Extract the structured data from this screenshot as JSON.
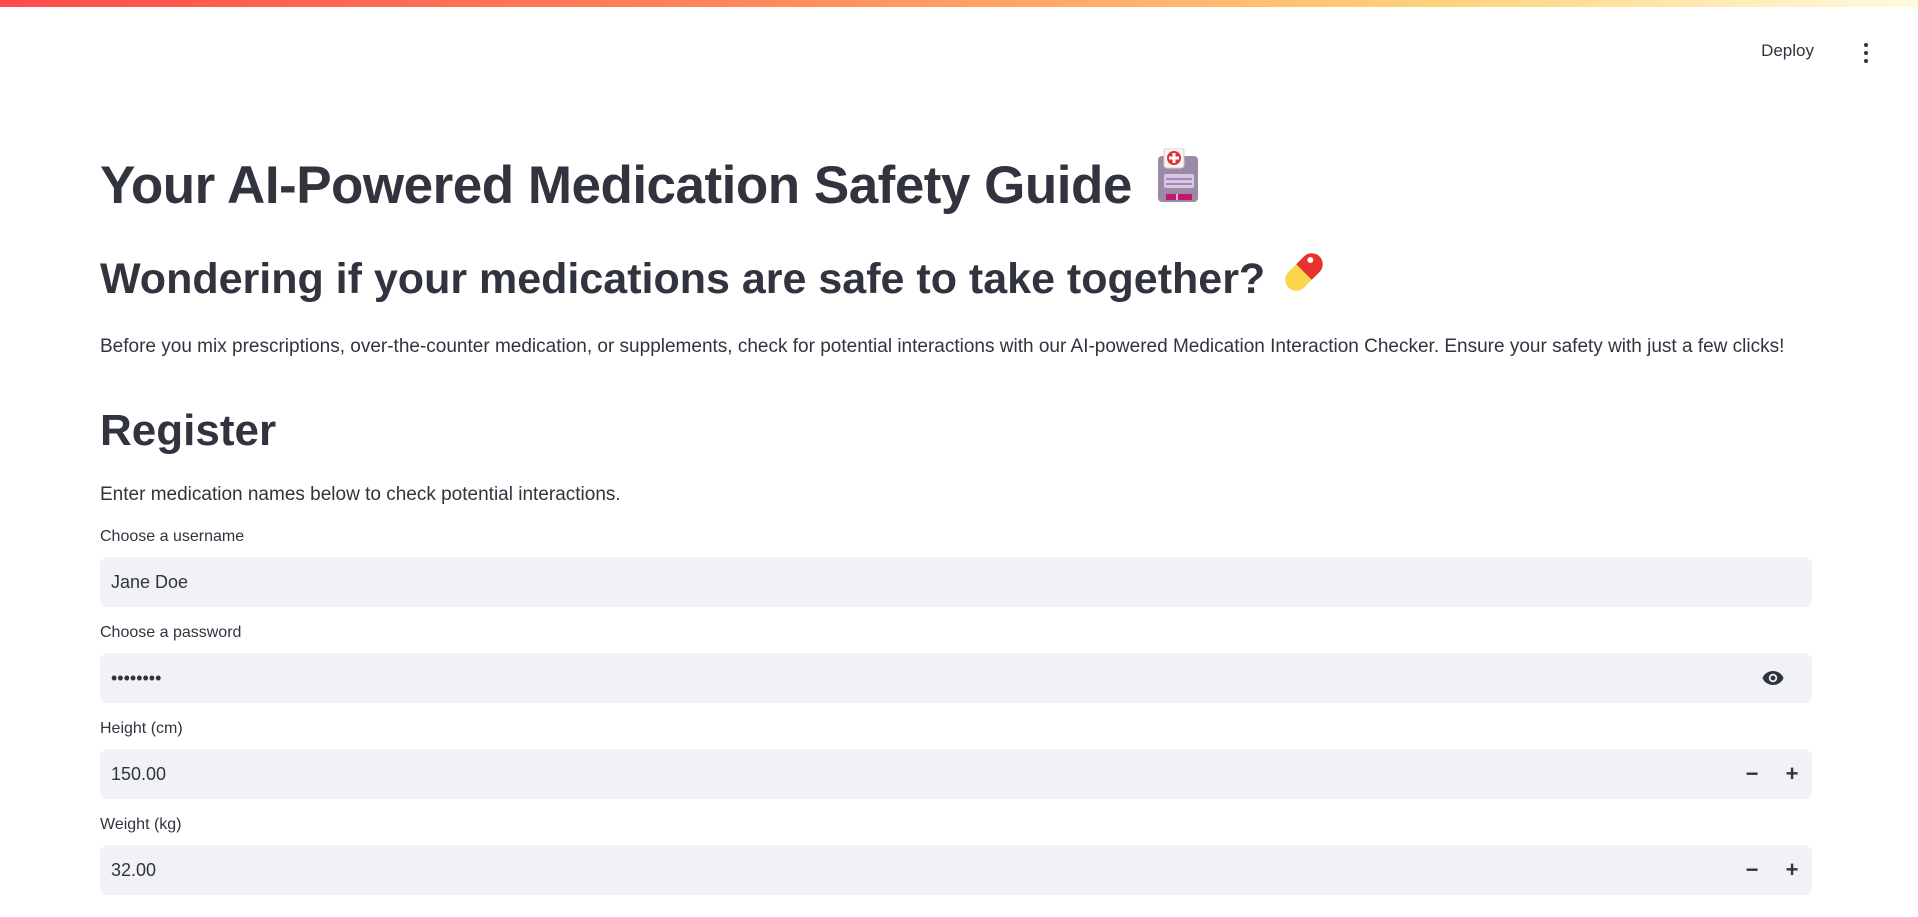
{
  "header": {
    "deploy_label": "Deploy"
  },
  "main": {
    "title": "Your AI-Powered Medication Safety Guide",
    "title_icon": "hospital-icon",
    "subtitle": "Wondering if your medications are safe to take together?",
    "subtitle_icon": "pill-icon",
    "intro": "Before you mix prescriptions, over-the-counter medication, or supplements, check for potential interactions with our AI-powered Medication Interaction Checker. Ensure your safety with just a few clicks!",
    "section_title": "Register",
    "section_desc": "Enter medication names below to check potential interactions."
  },
  "form": {
    "username": {
      "label": "Choose a username",
      "value": "Jane Doe"
    },
    "password": {
      "label": "Choose a password",
      "value": "password"
    },
    "height": {
      "label": "Height (cm)",
      "value": "150.00"
    },
    "weight": {
      "label": "Weight (kg)",
      "value": "32.00"
    }
  },
  "colors": {
    "accent": "#ff4b4b",
    "input_bg": "#f0f2f6",
    "text": "#31333f"
  }
}
